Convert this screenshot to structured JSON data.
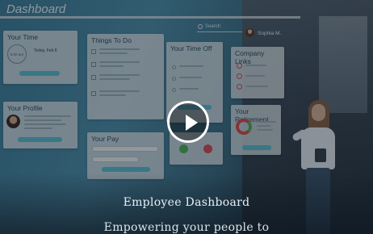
{
  "dashboard": {
    "title": "Dashboard",
    "search_placeholder": "Search",
    "user_name": "Sophia M."
  },
  "cards": {
    "your_time": "Your Time",
    "time_date": "Today, Feb 8",
    "clock_label": "8:30 am",
    "your_profile": "Your Profile",
    "things_to_do": "Things To Do",
    "your_pay": "Your Pay",
    "your_time_off": "Your Time Off",
    "company_links": "Company Links",
    "your_retirement": "Your Retirement"
  },
  "video": {
    "headline": "Employee Dashboard",
    "subline": "Empowering your people to"
  },
  "colors": {
    "accent": "#5bbfd2",
    "positive": "#52b15a",
    "negative": "#d94c52"
  }
}
